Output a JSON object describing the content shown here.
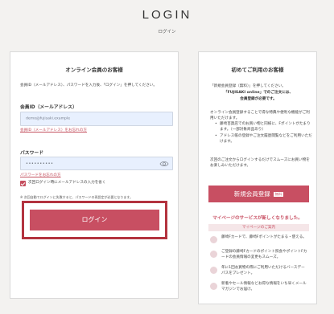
{
  "header": {
    "title": "LOGIN",
    "subtitle": "ログイン"
  },
  "login": {
    "heading": "オンライン会員のお客様",
    "description": "会員ID（メールアドレス）、パスワードを入力後、「ログイン」を押してください。",
    "id_label": "会員ID（メールアドレス）",
    "id_value": "demo@fujisaki.example",
    "forgot_id_link": "会員ID（メールアドレス）をお忘れの方",
    "password_label": "パスワード",
    "password_value": "••••••••••",
    "forgot_password_link": "パスワードをお忘れの方",
    "remember_label": "次回ログイン時にメールアドレスの入力を省く",
    "note": "※ 次回自動でログインに失敗すると、パスワードの再設定が必要となります。",
    "submit_label": "ログイン"
  },
  "register": {
    "heading": "初めてご利用のお客様",
    "intro_line1": "「新規会員登録（無料）」を押してください。",
    "intro_line2": "「FUJISAKI online」でのご注文には、",
    "intro_line3": "会員登録が必要です。",
    "body": "オンライン会員登録することで得な特典や便利な機能がご利用いただけます。",
    "bullets": [
      "藤崎百貨店でのお買い物と同様に、Fポイントがたまります。（一部対象商品あり）",
      "アドレス帳の登録やご注文履歴閲覧などをご利用いただけます。"
    ],
    "after_text": "次回のご注文からログインするだけでスムーズにお買い物をお楽しみいただけます。",
    "button_label": "新規会員登録",
    "button_badge": "無料",
    "mypage_title": "マイページのサービスが新しくなりました。",
    "mypage_bar": "マイページのご案内",
    "benefits": [
      "藤崎Fカードで、藤崎Fポイントがたまる・使える。",
      "ご登録の藤崎Fカードのポイント照会やポイントFカードの会員情報の変更もスムーズ。",
      "年に1回お買物の際にご利用いただけるバースデーパスをプレゼント。",
      "新着やセール情報などお得な情報をいち早くメールマガジンでお届け。"
    ]
  }
}
